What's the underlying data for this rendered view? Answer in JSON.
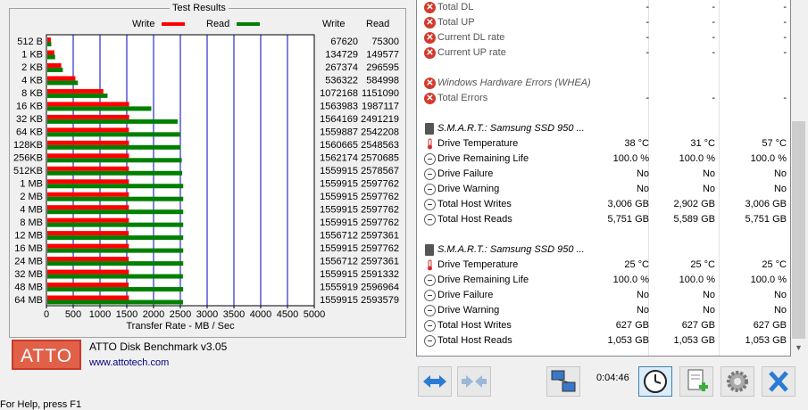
{
  "atto": {
    "results_title": "Test Results",
    "legend": {
      "write": "Write",
      "read": "Read",
      "write_color": "#ff0000",
      "read_color": "#008000"
    },
    "col_headers": {
      "write": "Write",
      "read": "Read"
    },
    "x_axis_title": "Transfer Rate - MB / Sec",
    "logo_text": "ATTO",
    "product_name": "ATTO Disk Benchmark v3.05",
    "website": "www.attotech.com",
    "status_help": "For Help, press F1"
  },
  "chart_data": {
    "type": "bar",
    "orientation": "horizontal",
    "categories": [
      "512 B",
      "1 KB",
      "2 KB",
      "4 KB",
      "8 KB",
      "16 KB",
      "32 KB",
      "64 KB",
      "128KB",
      "256KB",
      "512KB",
      "1 MB",
      "2 MB",
      "4 MB",
      "8 MB",
      "12 MB",
      "16 MB",
      "24 MB",
      "32 MB",
      "48 MB",
      "64 MB"
    ],
    "xlabel": "Transfer Rate - MB / Sec",
    "xlim": [
      0,
      5000
    ],
    "xticks": [
      0,
      500,
      1000,
      1500,
      2000,
      2500,
      3000,
      3500,
      4000,
      4500,
      5000
    ],
    "series": [
      {
        "name": "Write",
        "color": "#ff0000",
        "values": [
          66,
          132,
          261,
          524,
          1046,
          1527,
          1528,
          1523,
          1524,
          1526,
          1523,
          1523,
          1523,
          1523,
          1523,
          1520,
          1523,
          1520,
          1523,
          1519,
          1523
        ],
        "labels": [
          "67620",
          "134729",
          "267374",
          "536322",
          "1072168",
          "1563983",
          "1564169",
          "1559887",
          "1560665",
          "1562174",
          "1559915",
          "1559915",
          "1559915",
          "1559915",
          "1559915",
          "1556712",
          "1559915",
          "1556712",
          "1559915",
          "1555919",
          "1559915"
        ]
      },
      {
        "name": "Read",
        "color": "#008000",
        "values": [
          74,
          146,
          290,
          571,
          1124,
          1941,
          2433,
          2483,
          2489,
          2510,
          2518,
          2537,
          2537,
          2537,
          2537,
          2537,
          2537,
          2537,
          2531,
          2536,
          2533
        ],
        "labels": [
          "75300",
          "149577",
          "296595",
          "584998",
          "1151090",
          "1987117",
          "2491219",
          "2542208",
          "2548563",
          "2570685",
          "2578567",
          "2597762",
          "2597762",
          "2597762",
          "2597762",
          "2597361",
          "2597762",
          "2597361",
          "2591332",
          "2596964",
          "2593579"
        ]
      }
    ],
    "grid": true
  },
  "hwinfo": {
    "rows_top": [
      {
        "label": "Total DL",
        "v1": "-",
        "v2": "-",
        "v3": "-",
        "icon": "red-x"
      },
      {
        "label": "Total UP",
        "v1": "-",
        "v2": "-",
        "v3": "-",
        "icon": "red-x"
      },
      {
        "label": "Current DL rate",
        "v1": "-",
        "v2": "-",
        "v3": "-",
        "icon": "red-x"
      },
      {
        "label": "Current UP rate",
        "v1": "-",
        "v2": "-",
        "v3": "-",
        "icon": "red-x"
      }
    ],
    "whea_header": "Windows Hardware Errors (WHEA)",
    "whea_rows": [
      {
        "label": "Total Errors",
        "v1": "-",
        "v2": "-",
        "v3": "-"
      }
    ],
    "smart_sections": [
      {
        "header": "S.M.A.R.T.: Samsung SSD 950 ...",
        "rows": [
          {
            "label": "Drive Temperature",
            "v1": "38 °C",
            "v2": "31 °C",
            "v3": "57 °C",
            "icon": "thermometer"
          },
          {
            "label": "Drive Remaining Life",
            "v1": "100.0 %",
            "v2": "100.0 %",
            "v3": "100.0 %",
            "icon": "circle"
          },
          {
            "label": "Drive Failure",
            "v1": "No",
            "v2": "No",
            "v3": "No",
            "icon": "circle"
          },
          {
            "label": "Drive Warning",
            "v1": "No",
            "v2": "No",
            "v3": "No",
            "icon": "circle"
          },
          {
            "label": "Total Host Writes",
            "v1": "3,006 GB",
            "v2": "2,902 GB",
            "v3": "3,006 GB",
            "icon": "circle"
          },
          {
            "label": "Total Host Reads",
            "v1": "5,751 GB",
            "v2": "5,589 GB",
            "v3": "5,751 GB",
            "icon": "circle"
          }
        ]
      },
      {
        "header": "S.M.A.R.T.: Samsung SSD 950 ...",
        "rows": [
          {
            "label": "Drive Temperature",
            "v1": "25 °C",
            "v2": "25 °C",
            "v3": "25 °C",
            "icon": "thermometer"
          },
          {
            "label": "Drive Remaining Life",
            "v1": "100.0 %",
            "v2": "100.0 %",
            "v3": "100.0 %",
            "icon": "circle"
          },
          {
            "label": "Drive Failure",
            "v1": "No",
            "v2": "No",
            "v3": "No",
            "icon": "circle"
          },
          {
            "label": "Drive Warning",
            "v1": "No",
            "v2": "No",
            "v3": "No",
            "icon": "circle"
          },
          {
            "label": "Total Host Writes",
            "v1": "627 GB",
            "v2": "627 GB",
            "v3": "627 GB",
            "icon": "circle"
          },
          {
            "label": "Total Host Reads",
            "v1": "1,053 GB",
            "v2": "1,053 GB",
            "v3": "1,053 GB",
            "icon": "circle"
          }
        ]
      }
    ],
    "elapsed_time": "0:04:46"
  }
}
